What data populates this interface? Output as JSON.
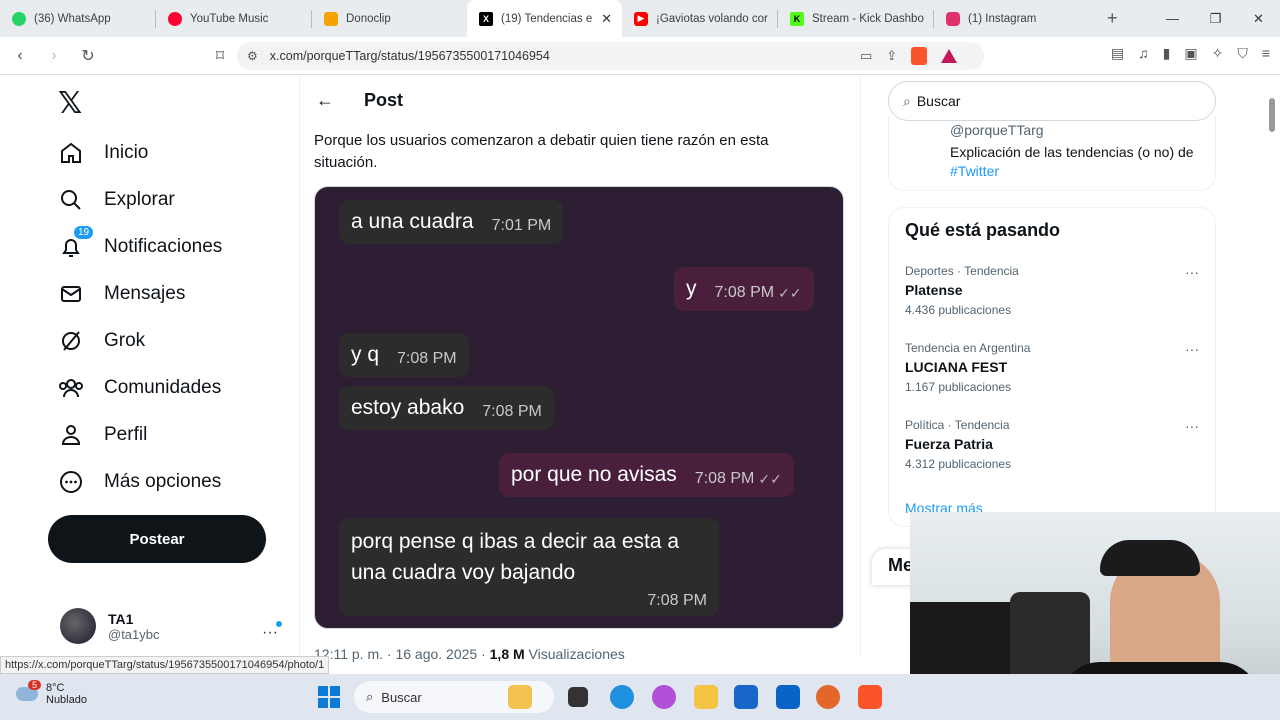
{
  "browser": {
    "tabs": [
      {
        "label": "(36) WhatsApp",
        "color": "#25d366"
      },
      {
        "label": "YouTube Music",
        "color": "#ff0033"
      },
      {
        "label": "Donoclip",
        "color": "#f4a300"
      },
      {
        "label": "(19) Tendencias e",
        "color": "#000000",
        "active": true
      },
      {
        "label": "¡Gaviotas volando cor",
        "color": "#ff0000"
      },
      {
        "label": "Stream - Kick Dashbo",
        "color": "#53fc18"
      },
      {
        "label": "(1) Instagram",
        "color": "#e1306c"
      }
    ],
    "url": "x.com/porqueTTarg/status/1956735500171046954",
    "status_url": "https://x.com/porqueTTarg/status/1956735500171046954/photo/1"
  },
  "nav": {
    "items": [
      {
        "label": "Inicio",
        "icon": "home-icon"
      },
      {
        "label": "Explorar",
        "icon": "search-icon"
      },
      {
        "label": "Notificaciones",
        "icon": "bell-icon",
        "badge": "19"
      },
      {
        "label": "Mensajes",
        "icon": "mail-icon"
      },
      {
        "label": "Grok",
        "icon": "grok-icon"
      },
      {
        "label": "Comunidades",
        "icon": "communities-icon"
      },
      {
        "label": "Perfil",
        "icon": "person-icon"
      },
      {
        "label": "Más opciones",
        "icon": "more-circle-icon"
      }
    ],
    "post_button": "Postear",
    "profile": {
      "name": "TA1",
      "handle": "@ta1ybc"
    }
  },
  "post": {
    "header": "Post",
    "text": "Porque los usuarios comenzaron a debatir quien tiene razón en esta situación.",
    "messages": [
      {
        "text": "a una cuadra",
        "time": "7:01 PM",
        "dir": "in"
      },
      {
        "text": "y",
        "time": "7:08 PM",
        "dir": "out"
      },
      {
        "text": "y q",
        "time": "7:08 PM",
        "dir": "in"
      },
      {
        "text": "estoy abako",
        "time": "7:08 PM",
        "dir": "in"
      },
      {
        "text": "por que no avisas",
        "time": "7:08 PM",
        "dir": "out"
      },
      {
        "text": "porq pense q ibas a decir aa esta a una cuadra voy bajando",
        "time": "7:08 PM",
        "dir": "in"
      }
    ],
    "meta": {
      "time": "12:11 p. m. · 16 ago. 2025 · ",
      "views": "1,8 M",
      "views_label": " Visualizaciones"
    }
  },
  "sidebar": {
    "search_placeholder": "Buscar",
    "account_card": {
      "handle": "@porqueTTarg",
      "desc": "Explicación de las tendencias (o no) de ",
      "hashtag": "#Twitter"
    },
    "trends_title": "Qué está pasando",
    "trends": [
      {
        "category": "Deportes · Tendencia",
        "name": "Platense",
        "count": "4.436 publicaciones"
      },
      {
        "category": "Tendencia en Argentina",
        "name": "LUCIANA FEST",
        "count": "1.167 publicaciones"
      },
      {
        "category": "Política · Tendencia",
        "name": "Fuerza Patria",
        "count": "4.312 publicaciones"
      }
    ],
    "show_more": "Mostrar más",
    "messages_float": "Me"
  },
  "taskbar": {
    "weather_temp": "8°C",
    "weather_desc": "Nublado",
    "weather_badge": "5",
    "search": "Buscar"
  }
}
